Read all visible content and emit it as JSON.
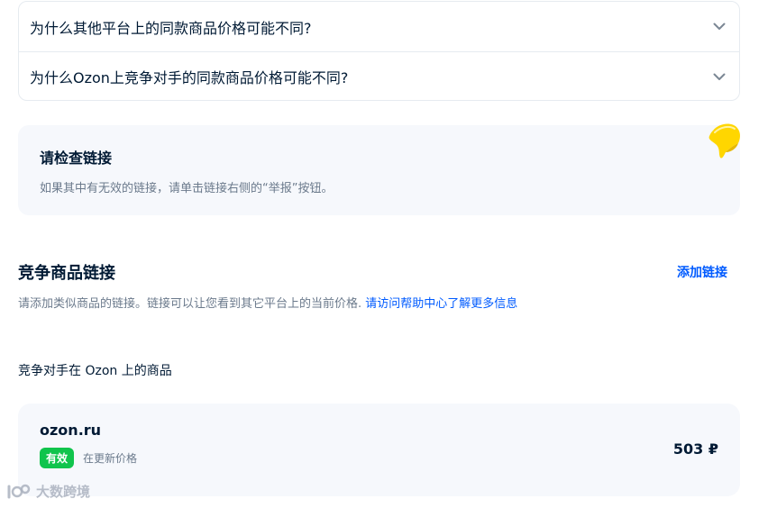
{
  "faq": {
    "items": [
      {
        "question": "为什么其他平台上的同款商品价格可能不同?"
      },
      {
        "question": "为什么Ozon上竞争对手的同款商品价格可能不同?"
      }
    ]
  },
  "notice": {
    "title": "请检查链接",
    "text": "如果其中有无效的链接，请单击链接右侧的“举报”按钮。"
  },
  "competitor_section": {
    "title": "竞争商品链接",
    "add_link_label": "添加链接",
    "description": "请添加类似商品的链接。链接可以让您看到其它平台上的当前价格. ",
    "help_link": "请访问帮助中心了解更多信息",
    "subtitle": "竞争对手在 Ozon 上的商品"
  },
  "competitor_items": [
    {
      "site": "ozon.ru",
      "status_badge": "有效",
      "status_text": "在更新价格",
      "price": "503 ₽"
    }
  ],
  "watermark": {
    "text": "大数跨境"
  },
  "colors": {
    "accent_link": "#005bff",
    "status_green": "#10c44c",
    "card_bg": "#f6f8fc",
    "text_primary": "#001a34",
    "text_secondary": "#6b7a8c",
    "star_yellow": "#ffd600"
  }
}
